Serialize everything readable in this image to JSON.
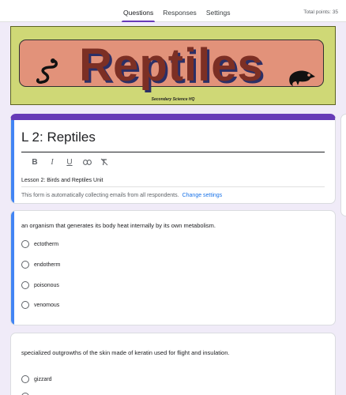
{
  "tabs": [
    {
      "label": "Questions",
      "active": true
    },
    {
      "label": "Responses",
      "active": false
    },
    {
      "label": "Settings",
      "active": false
    }
  ],
  "total_points": "Total points: 35",
  "banner": {
    "title": "Reptiles",
    "credit": "Secondary Science HQ"
  },
  "form": {
    "title": "L 2: Reptiles",
    "format_tools": [
      "B",
      "I",
      "U",
      "link",
      "clear-format"
    ],
    "description": "Lesson 2: Birds and Reptiles Unit",
    "email_note": "This form is automatically collecting emails from all respondents.",
    "change_settings": "Change settings"
  },
  "questions": [
    {
      "text": "an organism that generates its body heat internally by its own metabolism.",
      "options": [
        "ectotherm",
        "endotherm",
        "poisonous",
        "venomous"
      ]
    },
    {
      "text": "specialized outgrowths of the skin made of keratin used for flight and insulation.",
      "options": [
        "gizzard"
      ]
    }
  ],
  "colors": {
    "theme": "#673ab7",
    "selected_accent": "#4285f4",
    "background": "#f0ebf8",
    "banner_bg": "#cfd876",
    "banner_inner": "#e2927a",
    "link": "#1a73e8"
  }
}
